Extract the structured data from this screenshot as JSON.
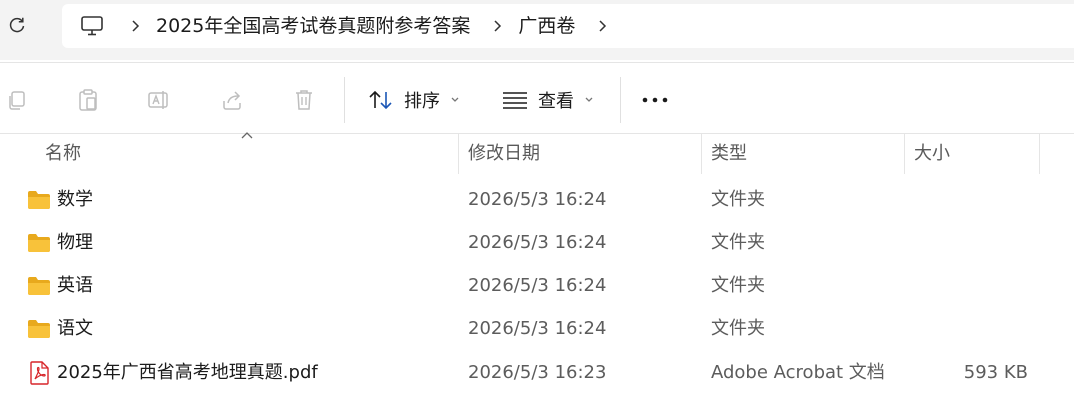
{
  "navigation": {
    "refresh_icon": "refresh-icon",
    "breadcrumb": [
      {
        "label": "2025年全国高考试卷真题附参考答案"
      },
      {
        "label": "广西卷"
      }
    ],
    "root_icon": "computer-icon"
  },
  "toolbar": {
    "disabled_icons": [
      "copy-icon",
      "paste-icon",
      "rename-icon",
      "share-icon",
      "delete-icon"
    ],
    "sort_label": "排序",
    "view_label": "查看",
    "more_icon": "more-icon"
  },
  "columns": {
    "name": "名称",
    "modified": "修改日期",
    "type": "类型",
    "size": "大小"
  },
  "files": [
    {
      "icon": "folder-icon",
      "name": "数学",
      "modified": "2026/5/3 16:24",
      "type": "文件夹",
      "size": ""
    },
    {
      "icon": "folder-icon",
      "name": "物理",
      "modified": "2026/5/3 16:24",
      "type": "文件夹",
      "size": ""
    },
    {
      "icon": "folder-icon",
      "name": "英语",
      "modified": "2026/5/3 16:24",
      "type": "文件夹",
      "size": ""
    },
    {
      "icon": "folder-icon",
      "name": "语文",
      "modified": "2026/5/3 16:24",
      "type": "文件夹",
      "size": ""
    },
    {
      "icon": "pdf-icon",
      "name": "2025年广西省高考地理真题.pdf",
      "modified": "2026/5/3 16:23",
      "type": "Adobe Acrobat 文档",
      "size": "593 KB"
    }
  ],
  "colors": {
    "folder": "#F8C23A",
    "pdf": "#D7252A",
    "chrome": "#F3F3F3",
    "disabled_icon": "#BEBEBE"
  }
}
